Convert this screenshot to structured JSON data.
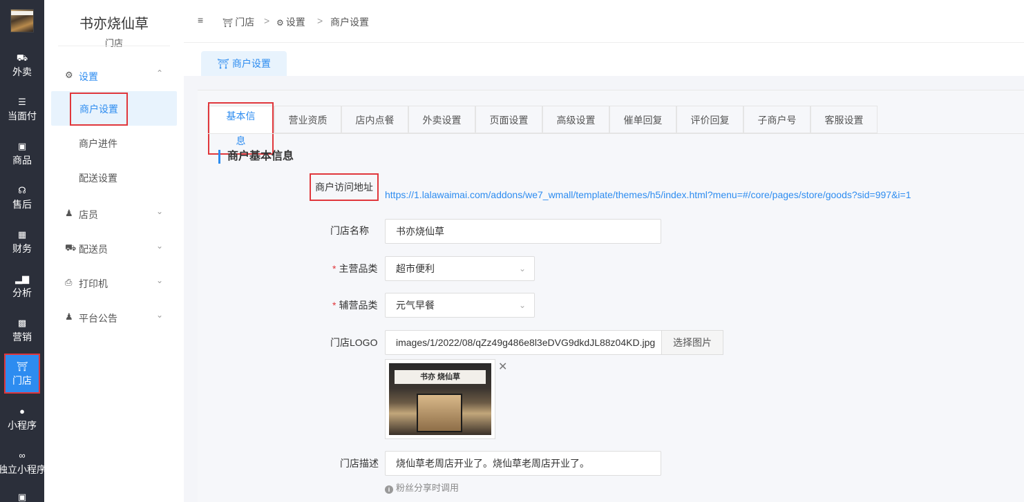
{
  "rail": {
    "items": [
      {
        "label": "外卖",
        "icon": "truck-icon"
      },
      {
        "label": "当面付",
        "icon": "list-icon"
      },
      {
        "label": "商品",
        "icon": "box-icon"
      },
      {
        "label": "售后",
        "icon": "headset-icon"
      },
      {
        "label": "财务",
        "icon": "ledger-icon"
      },
      {
        "label": "分析",
        "icon": "bar-chart-icon"
      },
      {
        "label": "营销",
        "icon": "gift-icon"
      },
      {
        "label": "门店",
        "icon": "store-icon"
      },
      {
        "label": "小程序",
        "icon": "wechat-icon"
      },
      {
        "label": "独立小程序",
        "icon": "link-icon"
      }
    ]
  },
  "sidebar": {
    "store_name": "书亦烧仙草",
    "store_label": "门店",
    "groups": [
      {
        "label": "设置",
        "icon": "gear-icon"
      },
      {
        "label": "店员",
        "icon": "staff-icon"
      },
      {
        "label": "配送员",
        "icon": "courier-icon"
      },
      {
        "label": "打印机",
        "icon": "printer-icon"
      },
      {
        "label": "平台公告",
        "icon": "announcement-icon"
      }
    ],
    "sub_items": [
      "商户设置",
      "商户进件",
      "配送设置"
    ]
  },
  "breadcrumb": {
    "items": [
      "门店",
      "设置",
      "商户设置"
    ],
    "separator": ">"
  },
  "page_tab": "商户设置",
  "tabs": [
    "基本信息",
    "营业资质",
    "店内点餐",
    "外卖设置",
    "页面设置",
    "高级设置",
    "催单回复",
    "评价回复",
    "子商户号",
    "客服设置"
  ],
  "section_title": "商户基本信息",
  "form": {
    "url_label": "商户访问地址",
    "url_value": "https://1.lalawaimai.com/addons/we7_wmall/template/themes/h5/index.html?menu=#/core/pages/store/goods?sid=997&i=1",
    "name_label": "门店名称",
    "name_value": "书亦烧仙草",
    "main_cat_label": "主营品类",
    "main_cat_value": "超市便利",
    "sub_cat_label": "辅营品类",
    "sub_cat_value": "元气早餐",
    "logo_label": "门店LOGO",
    "logo_value": "images/1/2022/08/qZz49g486e8l3eDVG9dkdJL88z04KD.jpg",
    "logo_button": "选择图片",
    "logo_preview_sign": "书亦 烧仙草",
    "desc_label": "门店描述",
    "desc_value": "烧仙草老周店开业了。烧仙草老周店开业了。",
    "desc_hint": "粉丝分享时调用"
  },
  "colors": {
    "accent": "#2d8cf0",
    "highlight": "#e0363b",
    "rail_bg": "#2b2f3a"
  }
}
